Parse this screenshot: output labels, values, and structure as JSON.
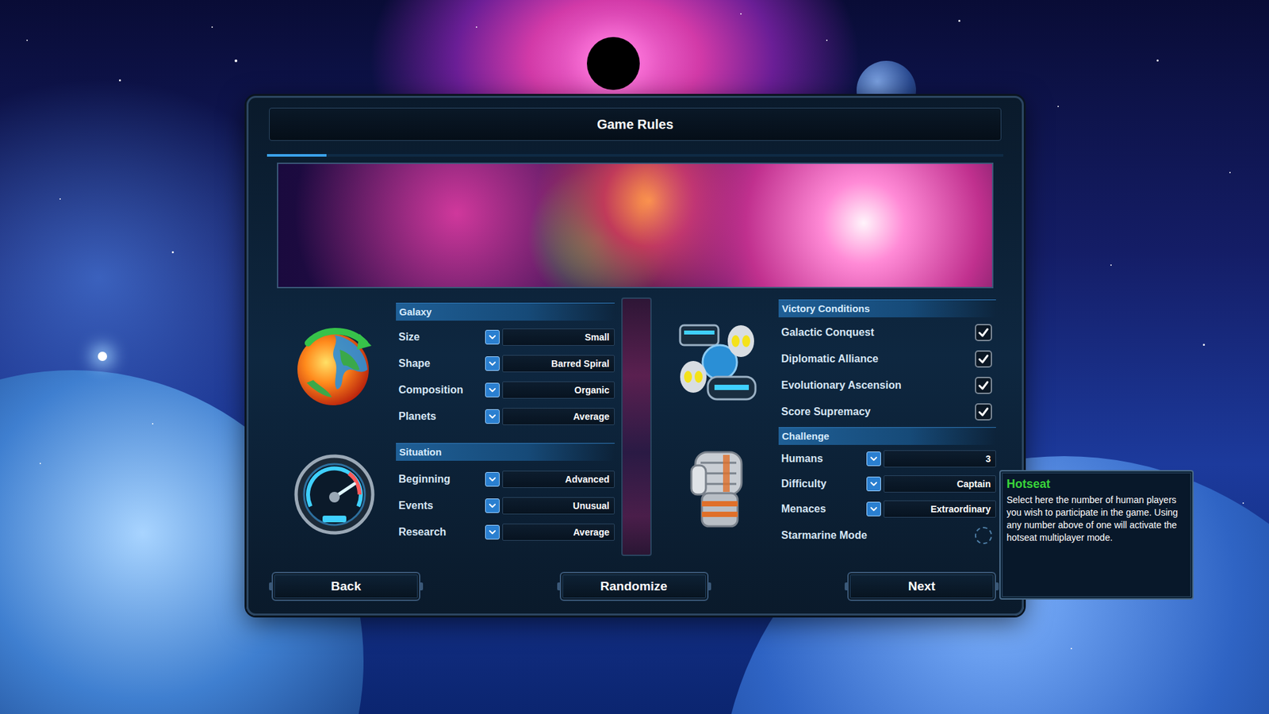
{
  "window": {
    "title": "Game Rules"
  },
  "galaxy": {
    "title": "Galaxy",
    "settings": [
      {
        "label": "Size",
        "value": "Small"
      },
      {
        "label": "Shape",
        "value": "Barred Spiral"
      },
      {
        "label": "Composition",
        "value": "Organic"
      },
      {
        "label": "Planets",
        "value": "Average"
      }
    ]
  },
  "situation": {
    "title": "Situation",
    "settings": [
      {
        "label": "Beginning",
        "value": "Advanced"
      },
      {
        "label": "Events",
        "value": "Unusual"
      },
      {
        "label": "Research",
        "value": "Average"
      }
    ]
  },
  "victory_conditions": {
    "title": "Victory Conditions",
    "items": [
      {
        "label": "Galactic Conquest",
        "checked": true
      },
      {
        "label": "Diplomatic Alliance",
        "checked": true
      },
      {
        "label": "Evolutionary Ascension",
        "checked": true
      },
      {
        "label": "Score Supremacy",
        "checked": true
      }
    ]
  },
  "challenge": {
    "title": "Challenge",
    "settings": [
      {
        "label": "Humans",
        "kind": "dropdown",
        "value": "3"
      },
      {
        "label": "Difficulty",
        "kind": "dropdown",
        "value": "Captain"
      },
      {
        "label": "Menaces",
        "kind": "dropdown",
        "value": "Extraordinary"
      },
      {
        "label": "Starmarine Mode",
        "kind": "checkbox",
        "checked": false
      }
    ]
  },
  "buttons": [
    {
      "label": "Back"
    },
    {
      "label": "Randomize"
    },
    {
      "label": "Next"
    }
  ],
  "tooltip": {
    "title": "Hotseat",
    "text": "Select here the number of human players you wish to participate in the game. Using any number above of one will activate the hotseat multiplayer mode."
  }
}
